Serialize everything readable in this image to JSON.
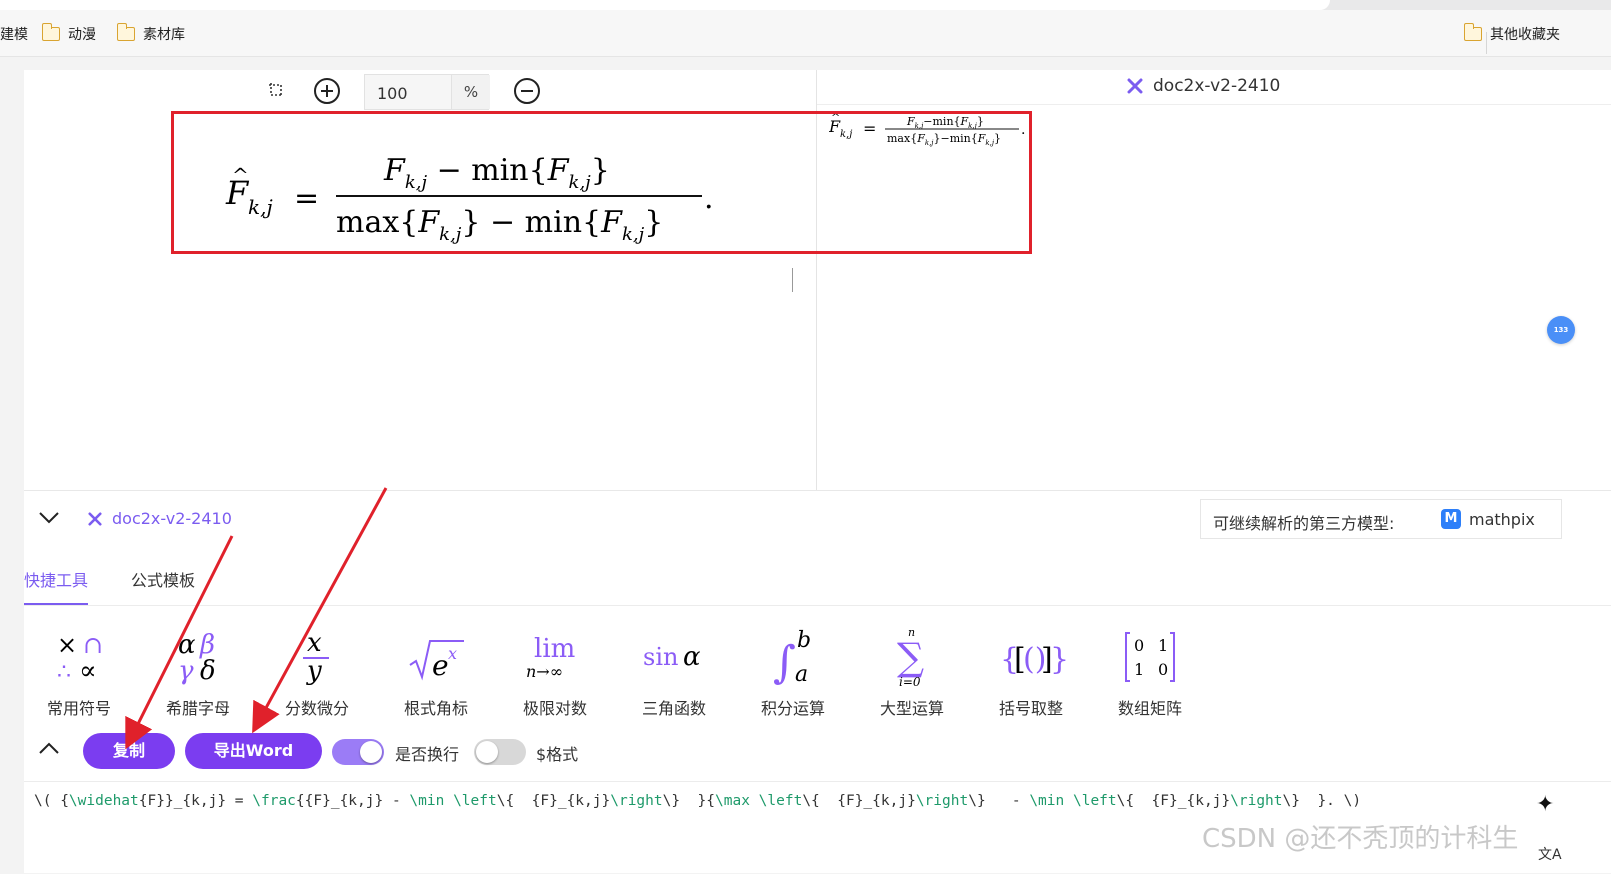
{
  "bookmarks": {
    "items": [
      "建模",
      "动漫",
      "素材库"
    ],
    "other": "其他收藏夹"
  },
  "viewer": {
    "zoom_value": "100",
    "zoom_unit": "%"
  },
  "result_panel": {
    "model_name": "doc2x-v2-2410"
  },
  "lower": {
    "model_name": "doc2x-v2-2410",
    "third_party_label": "可继续解析的第三方模型:",
    "third_party_model": "mathpix",
    "third_party_logo": "M"
  },
  "tabs": [
    {
      "label": "快捷工具",
      "active": true
    },
    {
      "label": "公式模板",
      "active": false
    }
  ],
  "tools": [
    {
      "label": "常用符号",
      "icon": "symbols-icon"
    },
    {
      "label": "希腊字母",
      "icon": "greek-icon"
    },
    {
      "label": "分数微分",
      "icon": "fraction-icon"
    },
    {
      "label": "根式角标",
      "icon": "radical-icon"
    },
    {
      "label": "极限对数",
      "icon": "limit-icon"
    },
    {
      "label": "三角函数",
      "icon": "trig-icon"
    },
    {
      "label": "积分运算",
      "icon": "integral-icon"
    },
    {
      "label": "大型运算",
      "icon": "sum-icon"
    },
    {
      "label": "括号取整",
      "icon": "brackets-icon"
    },
    {
      "label": "数组矩阵",
      "icon": "matrix-icon"
    }
  ],
  "actions": {
    "copy_label": "复制",
    "export_label": "导出Word",
    "wrap_label": "是否换行",
    "wrap_on": true,
    "dollar_label": "$格式",
    "dollar_on": false
  },
  "latex": "\\( {\\widehat{F}}_{k,j} = \\frac{{F}_{k,j} - \\min \\left\\{  {F}_{k,j}\\right\\}  }{\\max \\left\\{  {F}_{k,j}\\right\\}   - \\min \\left\\{  {F}_{k,j}\\right\\}  }. \\)",
  "side_badge": "133",
  "watermark": "CSDN @还不秃顶的计科生",
  "colors": {
    "accent": "#7b3df0",
    "annotation": "#e0212b",
    "latex_command": "#1e9a6a"
  }
}
